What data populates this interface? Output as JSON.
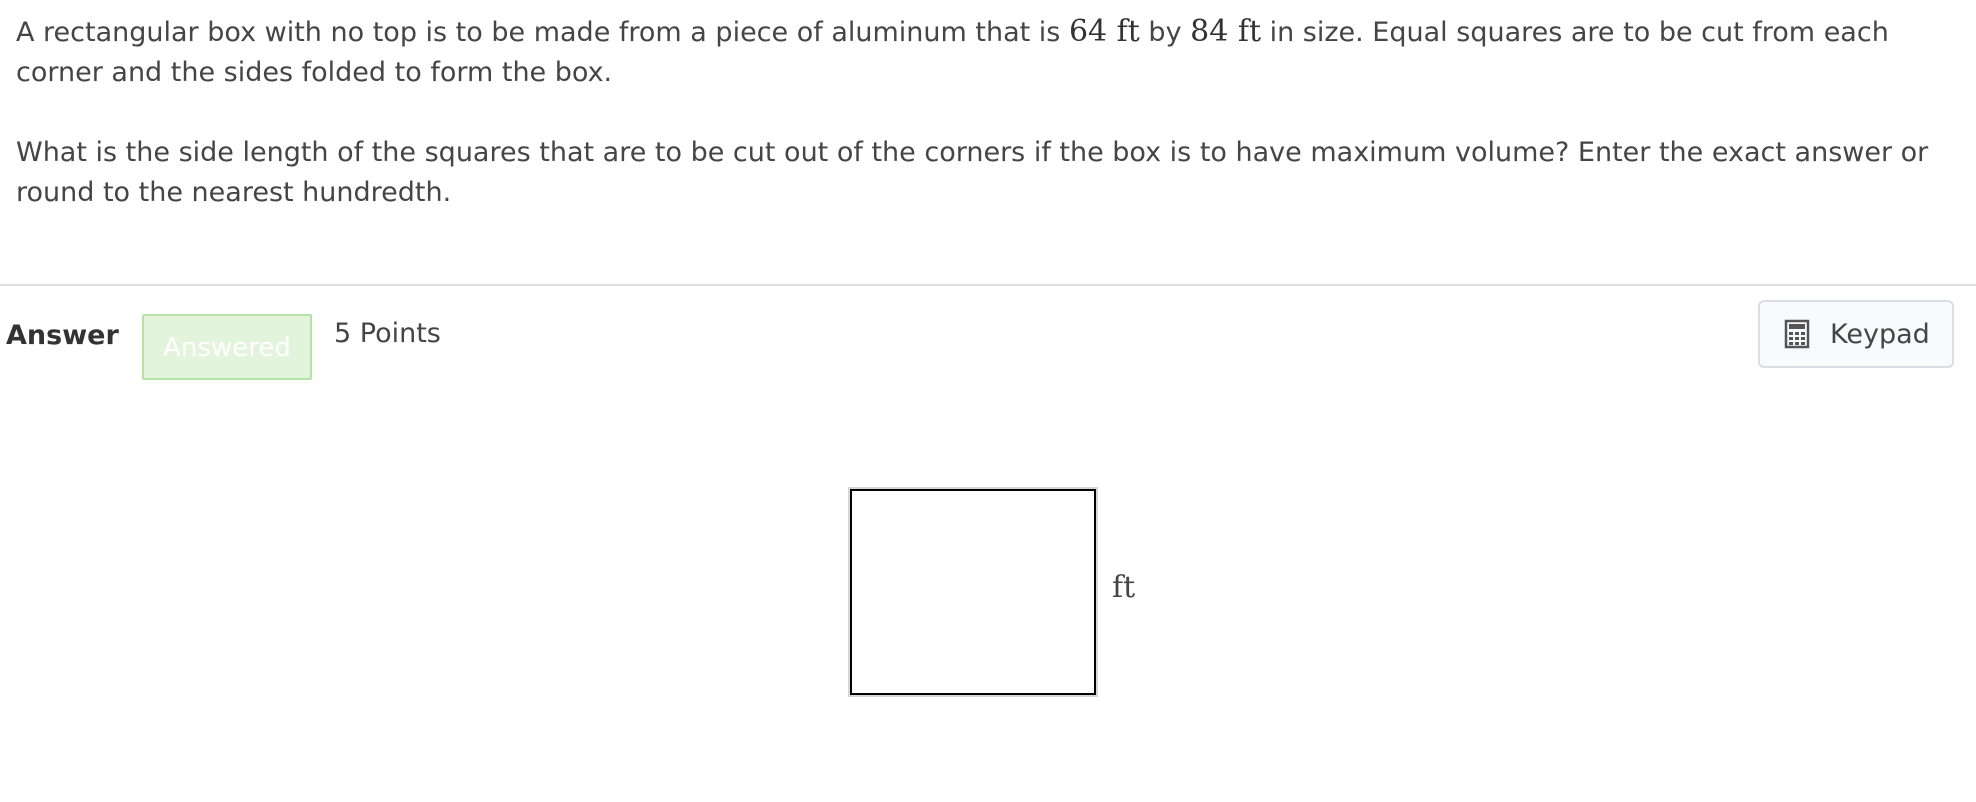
{
  "question": {
    "p1_prefix": "A rectangular box with no top is to be made from a piece of aluminum that is ",
    "dim1": "64 ft",
    "p1_mid": " by ",
    "dim2": "84 ft",
    "p1_suffix": " in size. Equal squares are to be cut from each corner and the sides folded to form the box.",
    "p2": "What is the side length of the squares that are to be cut out of the corners if the box is to have maximum volume? Enter the exact answer or round to the nearest hundredth."
  },
  "answer": {
    "label": "Answer",
    "status": "Answered",
    "points": "5 Points",
    "keypad_label": "Keypad",
    "keypad_icon": "calculator-icon",
    "input_value": "",
    "unit": "ft"
  },
  "colors": {
    "badge_bg": "#e2f4dc",
    "badge_border": "#b6e2a8",
    "divider": "#dedede",
    "text": "#454545"
  }
}
